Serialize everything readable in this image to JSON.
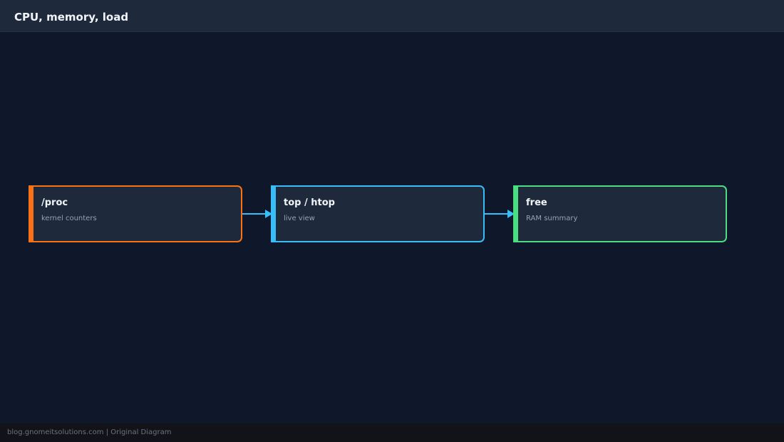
{
  "header": {
    "title": "CPU, memory, load"
  },
  "diagram": {
    "nodes": [
      {
        "id": "proc",
        "title": "/proc",
        "subtitle": "kernel counters",
        "color": "#f97316"
      },
      {
        "id": "top",
        "title": "top / htop",
        "subtitle": "live view",
        "color": "#38bdf8"
      },
      {
        "id": "free",
        "title": "free",
        "subtitle": "RAM summary",
        "color": "#4ade80"
      }
    ],
    "edges": [
      {
        "from": "proc",
        "to": "top",
        "color": "#38bdf8"
      },
      {
        "from": "top",
        "to": "free",
        "color": "#38bdf8"
      }
    ]
  },
  "footer": {
    "text": "blog.gnomeitsolutions.com | Original Diagram"
  }
}
